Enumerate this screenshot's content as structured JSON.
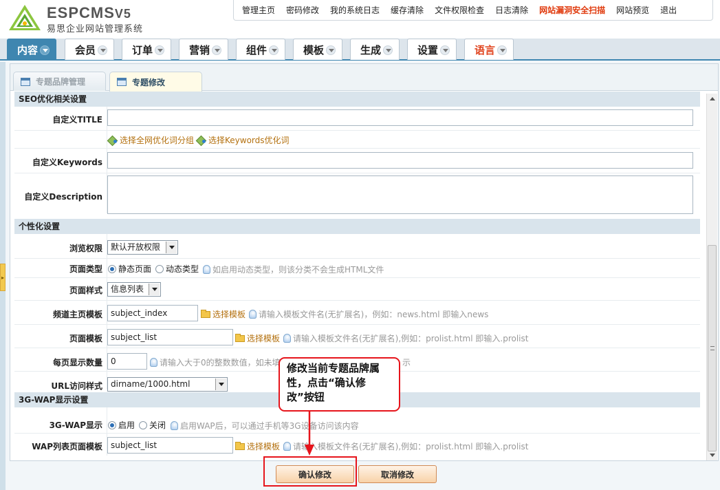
{
  "header": {
    "brand_main": "ESPCMS",
    "brand_version": "V5",
    "brand_subtitle": "易思企业网站管理系统",
    "top_links": [
      {
        "label": "管理主页",
        "highlight": false
      },
      {
        "label": "密码修改",
        "highlight": false
      },
      {
        "label": "我的系统日志",
        "highlight": false
      },
      {
        "label": "缓存清除",
        "highlight": false
      },
      {
        "label": "文件权限检查",
        "highlight": false
      },
      {
        "label": "日志清除",
        "highlight": false
      },
      {
        "label": "网站漏洞安全扫描",
        "highlight": true
      },
      {
        "label": "网站预览",
        "highlight": false
      },
      {
        "label": "退出",
        "highlight": false
      }
    ]
  },
  "main_tabs": [
    {
      "label": "内容",
      "active": true
    },
    {
      "label": "会员"
    },
    {
      "label": "订单"
    },
    {
      "label": "营销"
    },
    {
      "label": "组件"
    },
    {
      "label": "模板"
    },
    {
      "label": "生成"
    },
    {
      "label": "设置"
    },
    {
      "label": "语言",
      "accent": true
    }
  ],
  "sub_tabs": [
    {
      "label": "专题品牌管理",
      "active": false
    },
    {
      "label": "专题修改",
      "active": true
    }
  ],
  "form": {
    "seo_section": "SEO优化相关设置",
    "title_label": "自定义TITLE",
    "title_value": "",
    "link_all_keyword_group": "选择全网优化词分组",
    "link_keywords": "选择Keywords优化词",
    "keywords_label": "自定义Keywords",
    "keywords_value": "",
    "description_label": "自定义Description",
    "description_value": "",
    "personal_section": "个性化设置",
    "browse_perm_label": "浏览权限",
    "browse_perm_value": "默认开放权限",
    "page_type_label": "页面类型",
    "page_type_static": "静态页面",
    "page_type_dynamic": "动态类型",
    "page_type_hint": "如启用动态类型，则该分类不会生成HTML文件",
    "page_style_label": "页面样式",
    "page_style_value": "信息列表",
    "channel_tpl_label": "频道主页模板",
    "channel_tpl_value": "subject_index",
    "channel_tpl_hint": "请输入模板文件名(无扩展名)，例如：news.html 即输入news",
    "page_tpl_label": "页面模板",
    "page_tpl_value": "subject_list",
    "page_tpl_hint": "请输入模板文件名(无扩展名),例如：prolist.html 即输入.prolist",
    "select_tpl_link": "选择模板",
    "per_page_label": "每页显示数量",
    "per_page_value": "0",
    "per_page_hint": "请输入大于0的整数数值，如未填",
    "per_page_hint_tail": "示",
    "url_style_label": "URL访问样式",
    "url_style_value": "dirname/1000.html",
    "wap_section": "3G-WAP显示设置",
    "wap_show_label": "3G-WAP显示",
    "wap_on": "启用",
    "wap_off": "关闭",
    "wap_hint": "启用WAP后，可以通过手机等3G设备访问该内容",
    "wap_tpl_label": "WAP列表页面模板",
    "wap_tpl_value": "subject_list",
    "wap_tpl_hint": "请输入模板文件名(无扩展名),例如：prolist.html 即输入.prolist"
  },
  "buttons": {
    "confirm": "确认修改",
    "cancel": "取消修改"
  },
  "callout": {
    "text": "修改当前专题品牌属性，点击“确认修改”按钮"
  },
  "colors": {
    "accent_blue": "#3f86b0",
    "highlight_red": "#e6141b",
    "link_orange": "#b3700e"
  }
}
